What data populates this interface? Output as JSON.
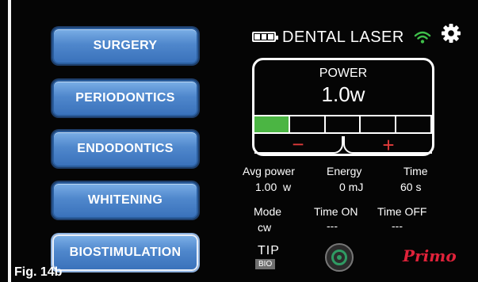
{
  "header": {
    "title": "DENTAL LASER",
    "battery_icon": "battery-full-icon",
    "wifi_icon": "wifi-icon",
    "settings_icon": "gear-icon",
    "accent_green": "#3fbf4a"
  },
  "menu": {
    "items": [
      {
        "label": "SURGERY"
      },
      {
        "label": "PERIODONTICS"
      },
      {
        "label": "ENDODONTICS"
      },
      {
        "label": "WHITENING"
      },
      {
        "label": "BIOSTIMULATION"
      }
    ],
    "selected": "BIOSTIMULATION",
    "button_color": "#4f87cc"
  },
  "power": {
    "label": "POWER",
    "value": "1.0w",
    "level_segments_total": 5,
    "level_segments_filled": 1,
    "minus_label": "−",
    "plus_label": "+",
    "segment_color": "#4bb543",
    "control_color": "#e23b3b"
  },
  "stats": {
    "avg_power": {
      "label": "Avg power",
      "value": "1.00  w"
    },
    "energy": {
      "label": "Energy",
      "value": "0 mJ"
    },
    "time": {
      "label": "Time",
      "value": "60 s"
    },
    "mode": {
      "label": "Mode",
      "value": "cw"
    },
    "time_on": {
      "label": "Time ON",
      "value": "---"
    },
    "time_off": {
      "label": "Time OFF",
      "value": "---"
    }
  },
  "footer": {
    "tip_label": "TIP",
    "tip_badge": "BIO",
    "laser_button_icon": "laser-emit-icon",
    "brand": "Primo",
    "brand_color": "#e0223a"
  },
  "caption": "Fig. 14b"
}
